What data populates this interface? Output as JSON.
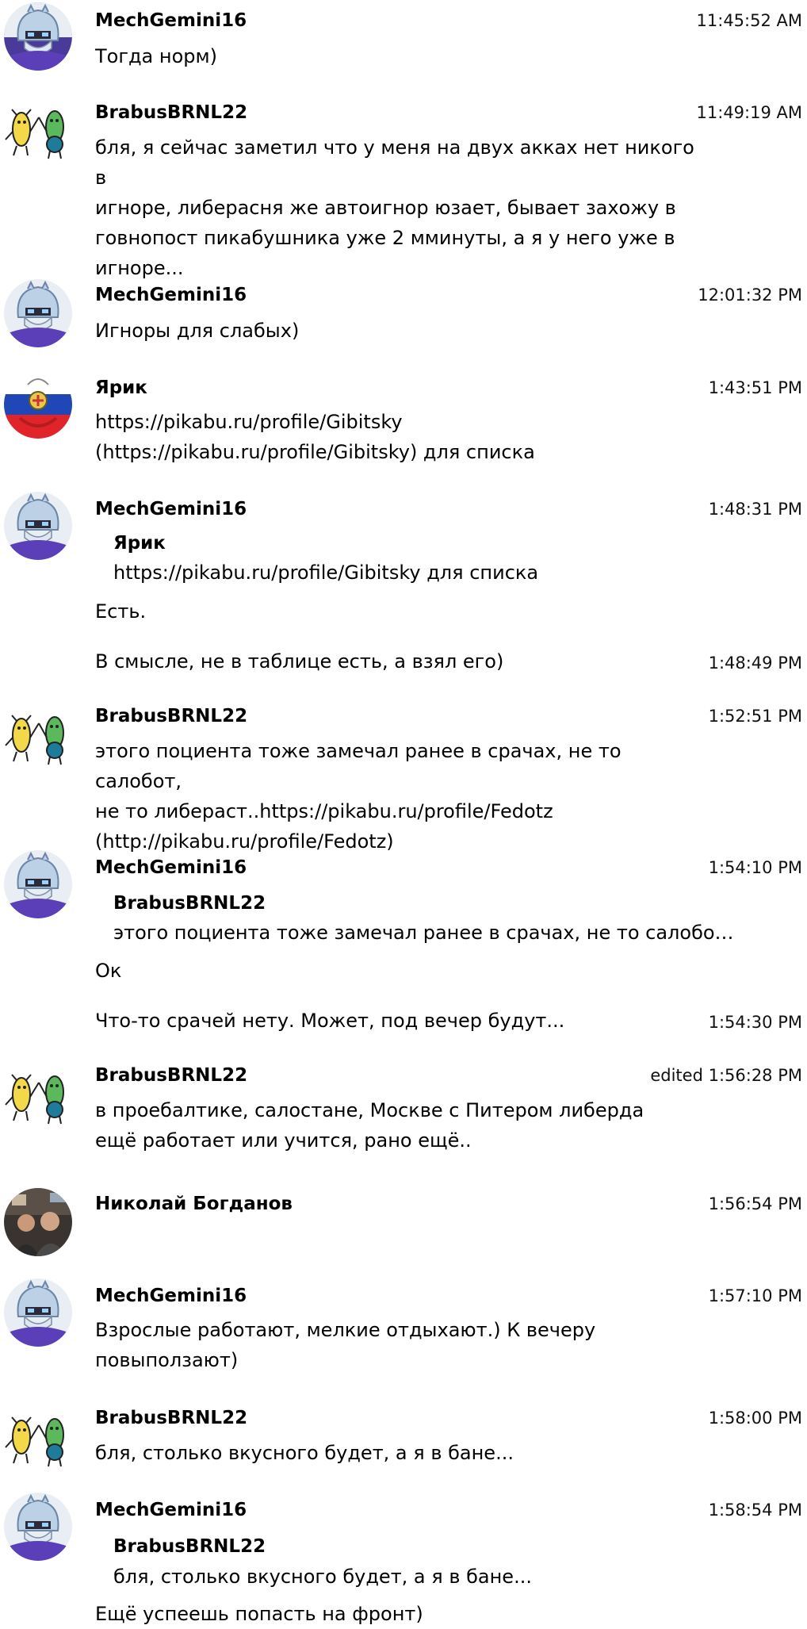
{
  "messages": [
    {
      "author": "MechGemini16",
      "time": "11:45:52 AM",
      "text": "Тогда норм)"
    },
    {
      "author": "BrabusBRNL22",
      "time": "11:49:19 AM",
      "lines": [
        "бля, я сейчас заметил что у меня на двух акках нет никого в",
        "игноре, либерасня же автоигнор юзает, бывает захожу в",
        "говнопост пикабушника уже 2 мминуты, а я у него уже в",
        "игноре..."
      ]
    },
    {
      "author": "MechGemini16",
      "time": "12:01:32 PM",
      "text": "Игноры для слабых)"
    },
    {
      "author": "Ярик",
      "time": "1:43:51 PM",
      "lines": [
        "https://pikabu.ru/profile/Gibitsky",
        "(https://pikabu.ru/profile/Gibitsky) для списка"
      ]
    },
    {
      "author": "MechGemini16",
      "time": "1:48:31 PM",
      "quote_author": "Ярик",
      "quote_text": "https://pikabu.ru/profile/Gibitsky для списка",
      "text": "Есть."
    },
    {
      "time": "1:48:49 PM",
      "text": "В смысле, не в таблице есть, а взял его)"
    },
    {
      "author": "BrabusBRNL22",
      "time": "1:52:51 PM",
      "lines": [
        "этого поциента тоже замечал ранее в срачах, не то салобот,",
        "не то либераст..https://pikabu.ru/profile/Fedotz",
        "(http://pikabu.ru/profile/Fedotz)"
      ]
    },
    {
      "author": "MechGemini16",
      "time": "1:54:10 PM",
      "quote_author": "BrabusBRNL22",
      "quote_text": "этого поциента тоже замечал ранее в срачах, не то салобо…",
      "text": "Ок"
    },
    {
      "time": "1:54:30 PM",
      "text": "Что-то срачей нету. Может, под вечер будут..."
    },
    {
      "author": "BrabusBRNL22",
      "time": "edited 1:56:28 PM",
      "lines": [
        "в проебалтике, салостане, Москве с Питером либерда",
        "ещё работает или учится, рано ещё.."
      ]
    },
    {
      "author": "Николай Богданов",
      "time": "1:56:54 PM"
    },
    {
      "author": "MechGemini16",
      "time": "1:57:10 PM",
      "lines": [
        "Взрослые работают, мелкие отдыхают.) К вечеру",
        "повыползают)"
      ]
    },
    {
      "author": "BrabusBRNL22",
      "time": "1:58:00 PM",
      "text": "бля, столько вкусного будет, а я в бане..."
    },
    {
      "author": "MechGemini16",
      "time": "1:58:54 PM",
      "quote_author": "BrabusBRNL22",
      "quote_text": "бля, столько вкусного будет, а я в бане...",
      "text": "Ещё успеешь попасть на фронт)"
    }
  ],
  "colors": {
    "accent_purple": "#5b3fb8",
    "avatar_flag_red": "#e0242a",
    "avatar_flag_blue": "#1f47b8"
  }
}
